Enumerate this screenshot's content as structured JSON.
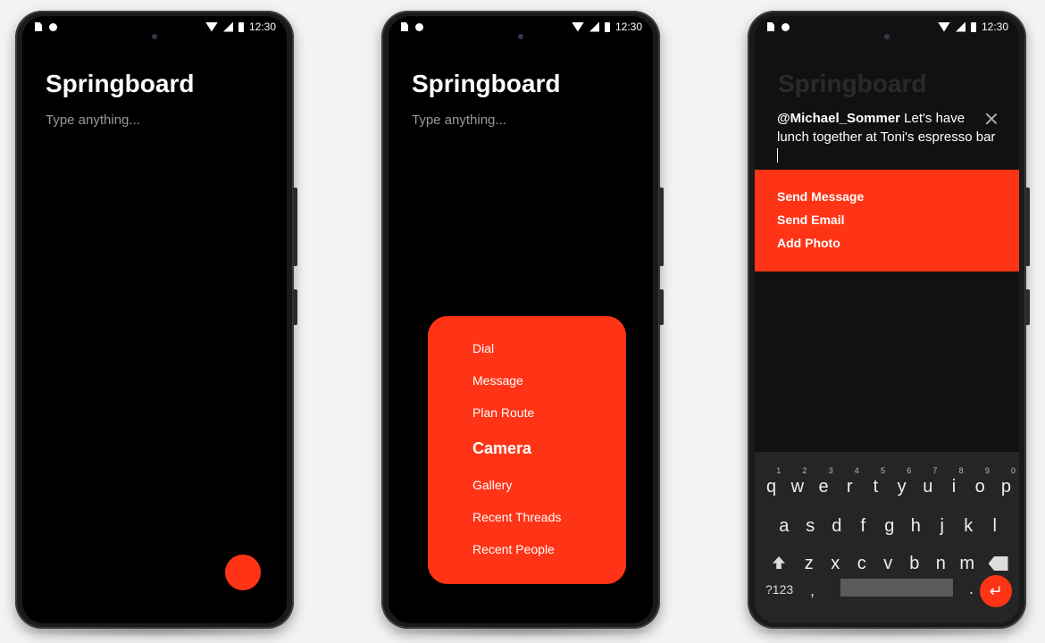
{
  "status": {
    "time": "12:30"
  },
  "screen1": {
    "title": "Springboard",
    "placeholder": "Type anything...",
    "fab_color": "#ff3416"
  },
  "screen2": {
    "title": "Springboard",
    "placeholder": "Type anything...",
    "menu": [
      "Dial",
      "Message",
      "Plan Route",
      "Camera",
      "Gallery",
      "Recent Threads",
      "Recent People"
    ],
    "highlighted": "Camera"
  },
  "screen3": {
    "title": "Springboard",
    "mention": "@Michael_Sommer",
    "message": " Let's have lunch together at Toni's espresso bar",
    "actions": [
      "Send Message",
      "Send Email",
      "Add Photo"
    ],
    "keyboard": {
      "row1": [
        "q",
        "w",
        "e",
        "r",
        "t",
        "y",
        "u",
        "i",
        "o",
        "p"
      ],
      "row1_hints": [
        "1",
        "2",
        "3",
        "4",
        "5",
        "6",
        "7",
        "8",
        "9",
        "0"
      ],
      "row2": [
        "a",
        "s",
        "d",
        "f",
        "g",
        "h",
        "j",
        "k",
        "l"
      ],
      "row3": [
        "z",
        "x",
        "c",
        "v",
        "b",
        "n",
        "m"
      ],
      "symbols_label": "?123",
      "comma": ",",
      "period": "."
    }
  },
  "colors": {
    "accent": "#ff3416",
    "background": "#000000"
  }
}
